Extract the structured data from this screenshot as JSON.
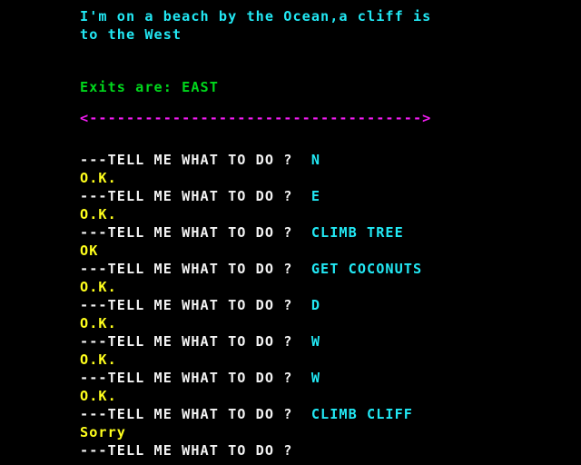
{
  "screen": {
    "background_color": "#000000",
    "colors": {
      "room_description": "#22E8F4",
      "exits": "#00D81C",
      "divider": "#F41CF4",
      "prompt": "#F2F2F2",
      "user_input": "#22E8F4",
      "response": "#FFFF1C"
    }
  },
  "room": {
    "description_line1": "I'm on a beach by the Ocean,a cliff is",
    "description_line2": "to the West",
    "exits_label": "Exits are: EAST",
    "divider": "<------------------------------------>"
  },
  "prompt_text": "---TELL ME WHAT TO DO ? ",
  "transcript": [
    {
      "prompt": "---TELL ME WHAT TO DO ? ",
      "input": " N",
      "response": "O.K."
    },
    {
      "prompt": "---TELL ME WHAT TO DO ? ",
      "input": " E",
      "response": "O.K."
    },
    {
      "prompt": "---TELL ME WHAT TO DO ? ",
      "input": " CLIMB TREE",
      "response": "OK"
    },
    {
      "prompt": "---TELL ME WHAT TO DO ? ",
      "input": " GET COCONUTS",
      "response": "O.K."
    },
    {
      "prompt": "---TELL ME WHAT TO DO ? ",
      "input": " D",
      "response": "O.K."
    },
    {
      "prompt": "---TELL ME WHAT TO DO ? ",
      "input": " W",
      "response": "O.K."
    },
    {
      "prompt": "---TELL ME WHAT TO DO ? ",
      "input": " W",
      "response": "O.K."
    },
    {
      "prompt": "---TELL ME WHAT TO DO ? ",
      "input": " CLIMB CLIFF",
      "response": "Sorry"
    }
  ],
  "active_prompt": {
    "prompt": "---TELL ME WHAT TO DO ?",
    "input": ""
  }
}
